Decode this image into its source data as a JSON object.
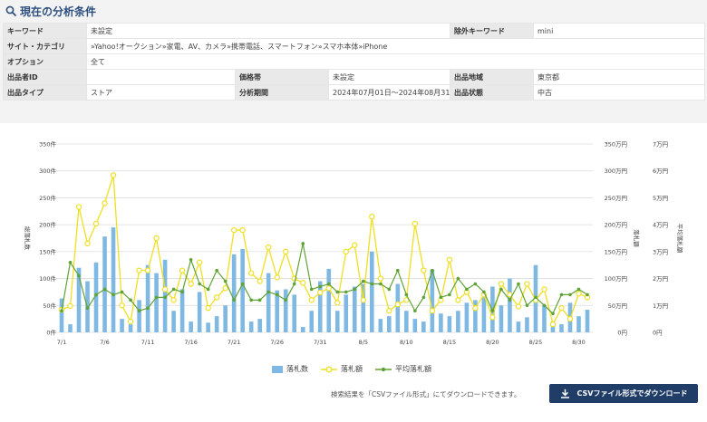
{
  "header": {
    "title": "現在の分析条件",
    "icon": "search-icon"
  },
  "conditions": {
    "row1": {
      "keyword_label": "キーワード",
      "keyword_value": "未設定",
      "exclude_label": "除外キーワード",
      "exclude_value": "mini"
    },
    "row2": {
      "category_label": "サイト・カテゴリ",
      "category_value": "»Yahoo!オークション»家電、AV、カメラ»携帯電話、スマートフォン»スマホ本体»iPhone"
    },
    "row3": {
      "option_label": "オプション",
      "option_value": "全て"
    },
    "row4": {
      "seller_label": "出品者ID",
      "seller_value": "",
      "price_label": "価格帯",
      "price_value": "未設定",
      "region_label": "出品地域",
      "region_value": "東京都"
    },
    "row5": {
      "type_label": "出品タイプ",
      "type_value": "ストア",
      "period_label": "分析期間",
      "period_value": "2024年07月01日～2024年08月31日",
      "condition_label": "出品状態",
      "condition_value": "中古"
    }
  },
  "chart_data": {
    "type": "bar",
    "categories": [
      "7/1",
      "7/2",
      "7/3",
      "7/4",
      "7/5",
      "7/6",
      "7/7",
      "7/8",
      "7/9",
      "7/10",
      "7/11",
      "7/12",
      "7/13",
      "7/14",
      "7/15",
      "7/16",
      "7/17",
      "7/18",
      "7/19",
      "7/20",
      "7/21",
      "7/22",
      "7/23",
      "7/24",
      "7/25",
      "7/26",
      "7/27",
      "7/28",
      "7/29",
      "7/30",
      "7/31",
      "8/1",
      "8/2",
      "8/3",
      "8/4",
      "8/5",
      "8/6",
      "8/7",
      "8/8",
      "8/9",
      "8/10",
      "8/11",
      "8/12",
      "8/13",
      "8/14",
      "8/15",
      "8/16",
      "8/17",
      "8/18",
      "8/19",
      "8/20",
      "8/21",
      "8/22",
      "8/23",
      "8/24",
      "8/25",
      "8/26",
      "8/27",
      "8/28",
      "8/29",
      "8/30",
      "8/31"
    ],
    "x_tick_labels": [
      "7/1",
      "7/6",
      "7/11",
      "7/16",
      "7/21",
      "7/26",
      "7/31",
      "8/5",
      "8/10",
      "8/15",
      "8/20",
      "8/25",
      "8/30"
    ],
    "series": [
      {
        "name": "落札数",
        "kind": "bar",
        "axis": "left",
        "color": "#7fb9e3",
        "values": [
          63,
          15,
          120,
          95,
          130,
          178,
          195,
          25,
          15,
          60,
          125,
          110,
          135,
          40,
          80,
          20,
          75,
          18,
          30,
          50,
          145,
          155,
          20,
          25,
          110,
          78,
          80,
          70,
          10,
          40,
          95,
          118,
          40,
          70,
          85,
          90,
          150,
          25,
          30,
          90,
          40,
          25,
          20,
          117,
          35,
          30,
          40,
          55,
          60,
          70,
          85,
          50,
          100,
          20,
          28,
          125,
          50,
          20,
          15,
          55,
          30,
          42
        ]
      },
      {
        "name": "落札額",
        "kind": "line",
        "axis": "right1",
        "color": "#f0df20",
        "values": [
          42,
          49,
          233,
          165,
          202,
          240,
          292,
          50,
          20,
          115,
          115,
          175,
          80,
          60,
          115,
          90,
          130,
          45,
          65,
          82,
          190,
          190,
          110,
          95,
          158,
          102,
          150,
          100,
          92,
          60,
          74,
          82,
          55,
          150,
          162,
          60,
          215,
          100,
          40,
          52,
          60,
          202,
          115,
          40,
          60,
          135,
          60,
          75,
          45,
          70,
          28,
          90,
          70,
          48,
          90,
          60,
          80,
          15,
          45,
          25,
          72,
          65
        ]
      },
      {
        "name": "平均落札額",
        "kind": "line",
        "axis": "right2",
        "color": "#5fa336",
        "values": [
          0.8,
          2.6,
          2.1,
          0.9,
          1.4,
          1.6,
          1.4,
          1.5,
          1.2,
          0.8,
          0.9,
          1.3,
          1.3,
          1.6,
          1.5,
          2.7,
          1.8,
          1.6,
          2.3,
          1.9,
          1.2,
          1.8,
          1.2,
          1.2,
          1.5,
          1.4,
          1.2,
          1.8,
          3.3,
          1.6,
          1.7,
          1.8,
          1.5,
          1.5,
          1.6,
          1.9,
          1.8,
          1.8,
          1.6,
          2.3,
          1.4,
          0.8,
          1.3,
          2.3,
          1.3,
          1.4,
          2.0,
          1.6,
          1.8,
          1.5,
          0.8,
          1.6,
          1.2,
          1.8,
          1.0,
          1.3,
          1.0,
          0.7,
          1.4,
          1.4,
          1.6,
          1.4
        ]
      }
    ],
    "y_axes": {
      "left": {
        "ylabel": "総落札数",
        "ylim": [
          0,
          350
        ],
        "ticks": [
          "0件",
          "50件",
          "100件",
          "150件",
          "200件",
          "250件",
          "300件",
          "350件"
        ]
      },
      "right1": {
        "ylabel": "落札額",
        "ylim": [
          0,
          350
        ],
        "ticks": [
          "0円",
          "50万円",
          "100万円",
          "150万円",
          "200万円",
          "250万円",
          "300万円",
          "350万円"
        ]
      },
      "right2": {
        "ylabel": "平均落札額",
        "ylim": [
          0,
          7
        ],
        "ticks": [
          "0円",
          "1万円",
          "2万円",
          "3万円",
          "4万円",
          "5万円",
          "6万円",
          "7万円"
        ]
      }
    },
    "grid": true,
    "legend": "bottom-center"
  },
  "footer": {
    "note": "検索結果を「CSVファイル形式」にてダウンロードできます。",
    "csv_button_label": "CSVファイル形式でダウンロード",
    "csv_icon": "download-icon"
  }
}
